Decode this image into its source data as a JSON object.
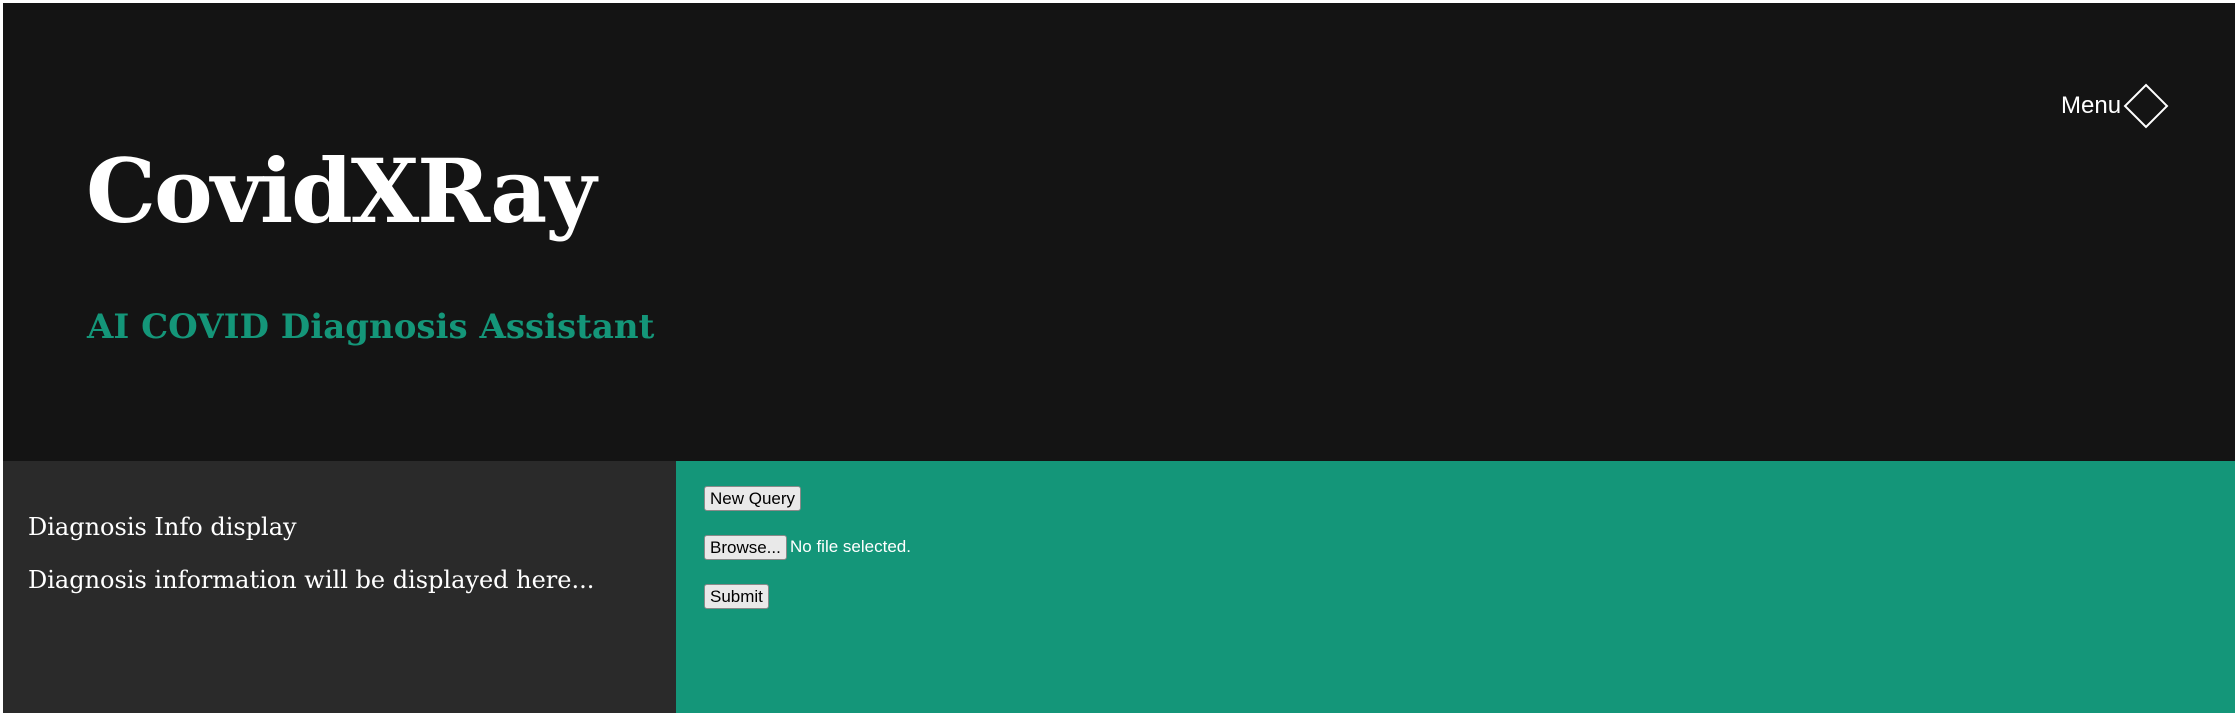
{
  "header": {
    "title": "CovidXRay",
    "subtitle": "AI COVID Diagnosis Assistant",
    "menu_label": "Menu",
    "menu_icon": "diamond-icon"
  },
  "info_panel": {
    "heading": "Diagnosis Info display",
    "placeholder_text": "Diagnosis information will be displayed here..."
  },
  "query_panel": {
    "new_query_label": "New Query",
    "browse_label": "Browse...",
    "file_status": "No file selected.",
    "submit_label": "Submit"
  },
  "colors": {
    "header_bg": "#141414",
    "accent": "#149679",
    "info_bg": "#2a2a2a",
    "text": "#ffffff"
  }
}
